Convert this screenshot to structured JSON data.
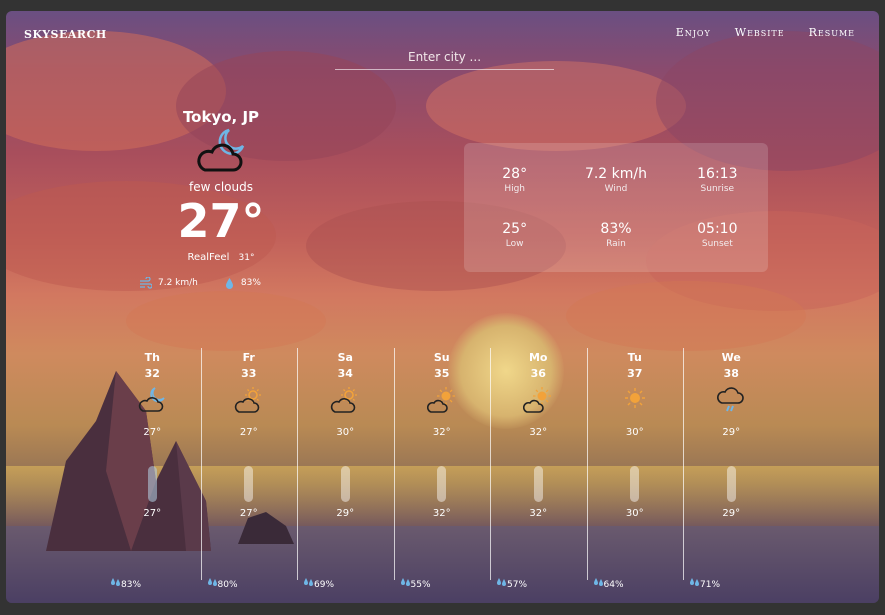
{
  "brand": "SKYSEARCH",
  "nav": {
    "enjoy": "Enjoy",
    "website": "Website",
    "resume": "Resume"
  },
  "search": {
    "placeholder": "Enter city ..."
  },
  "current": {
    "city": "Tokyo, JP",
    "icon": "moon-cloud-icon",
    "condition": "few clouds",
    "temp": "27°",
    "realfeel_label": "RealFeel",
    "realfeel_value": "31°",
    "wind": "7.2 km/h",
    "humidity": "83%"
  },
  "stats": {
    "high": {
      "value": "28°",
      "label": "High"
    },
    "wind": {
      "value": "7.2 km/h",
      "label": "Wind"
    },
    "sunrise": {
      "value": "16:13",
      "label": "Sunrise"
    },
    "low": {
      "value": "25°",
      "label": "Low"
    },
    "rain": {
      "value": "83%",
      "label": "Rain"
    },
    "sunset": {
      "value": "05:10",
      "label": "Sunset"
    }
  },
  "forecast": [
    {
      "day": "Th",
      "num": "32",
      "icon": "moon-cloud-icon",
      "hi": "27°",
      "lo": "27°",
      "rain": "83%"
    },
    {
      "day": "Fr",
      "num": "33",
      "icon": "sun-cloud-icon",
      "hi": "27°",
      "lo": "27°",
      "rain": "80%"
    },
    {
      "day": "Sa",
      "num": "34",
      "icon": "sun-cloud-icon",
      "hi": "30°",
      "lo": "29°",
      "rain": "69%"
    },
    {
      "day": "Su",
      "num": "35",
      "icon": "sun-cloud-icon",
      "hi": "32°",
      "lo": "32°",
      "rain": "55%"
    },
    {
      "day": "Mo",
      "num": "36",
      "icon": "sun-cloud-icon",
      "hi": "32°",
      "lo": "32°",
      "rain": "57%"
    },
    {
      "day": "Tu",
      "num": "37",
      "icon": "sun-icon",
      "hi": "30°",
      "lo": "30°",
      "rain": "64%"
    },
    {
      "day": "We",
      "num": "38",
      "icon": "rain-cloud-icon",
      "hi": "29°",
      "lo": "29°",
      "rain": "71%"
    }
  ],
  "colors": {
    "accent_blue": "#6fb6e6",
    "sun_orange": "#f2a23a",
    "background": "#333333"
  }
}
